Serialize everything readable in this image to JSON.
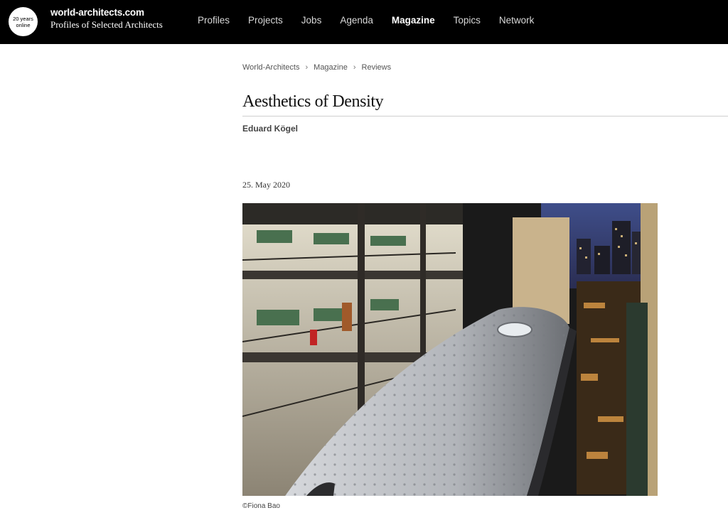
{
  "header": {
    "badge_line1": "20 years",
    "badge_line2": "online",
    "brand_name": "world-architects.com",
    "brand_tagline": "Profiles of Selected Architects",
    "nav": [
      "Profiles",
      "Projects",
      "Jobs",
      "Agenda",
      "Magazine",
      "Topics",
      "Network"
    ],
    "active_nav": "Magazine"
  },
  "breadcrumb": [
    "World-Architects",
    "Magazine",
    "Reviews"
  ],
  "article": {
    "title": "Aesthetics of Density",
    "author": "Eduard Kögel",
    "date": "25. May 2020",
    "photo_credit": "©Fiona Bao"
  },
  "colors": {
    "topbar": "#000000",
    "background": "#ffffff",
    "text": "#222222"
  }
}
